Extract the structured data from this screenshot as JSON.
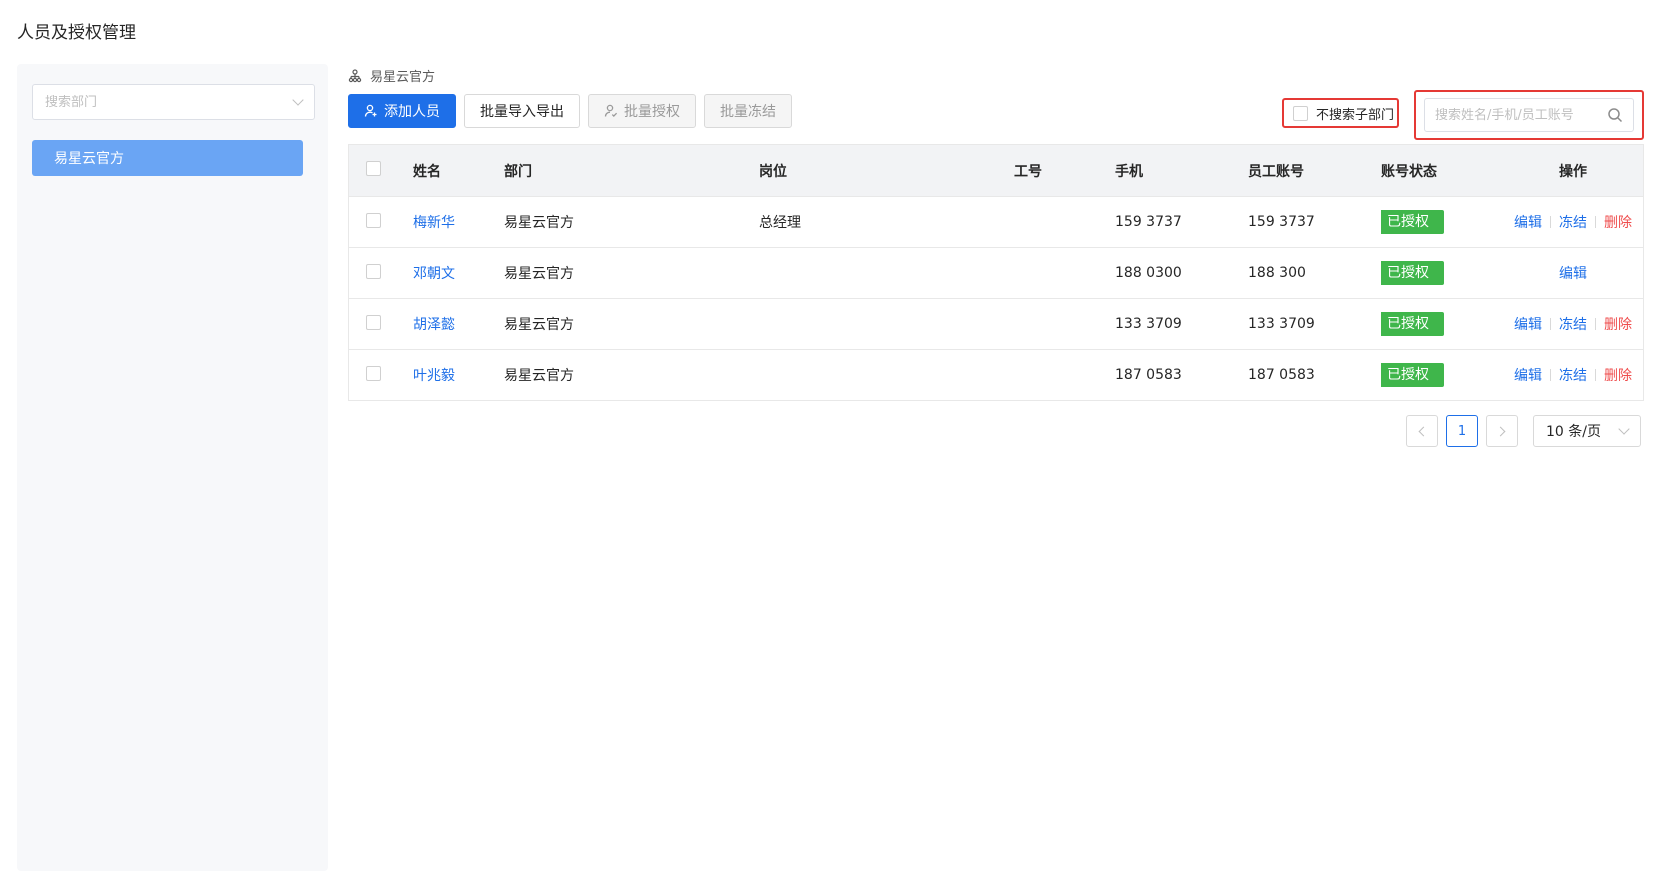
{
  "page": {
    "title": "人员及授权管理"
  },
  "sidebar": {
    "search_placeholder": "搜索部门",
    "departments": [
      {
        "label": "易星云官方",
        "selected": true
      }
    ]
  },
  "main": {
    "breadcrumb": "易星云官方",
    "toolbar": {
      "add_person": "添加人员",
      "batch_import_export": "批量导入导出",
      "batch_authorize": "批量授权",
      "batch_freeze": "批量冻结"
    },
    "filters": {
      "exclude_sub_dept_label": "不搜索子部门",
      "exclude_sub_dept_checked": false,
      "search_placeholder": "搜索姓名/手机/员工账号"
    },
    "table": {
      "headers": {
        "name": "姓名",
        "department": "部门",
        "position": "岗位",
        "employee_no": "工号",
        "phone": "手机",
        "account": "员工账号",
        "status": "账号状态",
        "actions": "操作"
      },
      "rows": [
        {
          "name": "梅新华",
          "department": "易星云官方",
          "position": "总经理",
          "employee_no": "",
          "phone": "159     3737",
          "account": "159     3737",
          "status": "已授权",
          "actions": [
            "编辑",
            "冻结",
            "删除"
          ]
        },
        {
          "name": "邓朝文",
          "department": "易星云官方",
          "position": "",
          "employee_no": "",
          "phone": "188     0300",
          "account": "188     300",
          "status": "已授权",
          "actions": [
            "编辑"
          ]
        },
        {
          "name": "胡泽懿",
          "department": "易星云官方",
          "position": "",
          "employee_no": "",
          "phone": "133     3709",
          "account": "133     3709",
          "status": "已授权",
          "actions": [
            "编辑",
            "冻结",
            "删除"
          ]
        },
        {
          "name": "叶兆毅",
          "department": "易星云官方",
          "position": "",
          "employee_no": "",
          "phone": "187     0583",
          "account": "187     0583",
          "status": "已授权",
          "actions": [
            "编辑",
            "冻结",
            "删除"
          ]
        }
      ]
    },
    "pagination": {
      "current_page": "1",
      "page_size": "10 条/页"
    }
  },
  "colors": {
    "primary": "#1e6fe8",
    "success": "#3fb64b",
    "danger": "#ef4c4c",
    "highlight_box": "#e53935"
  }
}
